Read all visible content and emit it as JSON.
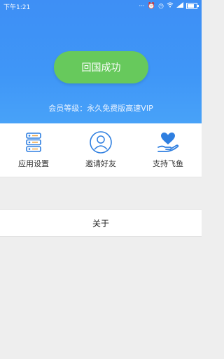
{
  "status_bar": {
    "time": "下午1:21",
    "icons": [
      "dots-icon",
      "alarm-icon",
      "clock-icon",
      "wifi-icon",
      "signal-icon",
      "battery-icon"
    ]
  },
  "hero": {
    "button_label": "回国成功",
    "member_text": "会员等级：永久免费版高速VIP"
  },
  "menu": {
    "items": [
      {
        "label": "应用设置",
        "icon": "settings-stack-icon"
      },
      {
        "label": "邀请好友",
        "icon": "person-circle-icon"
      },
      {
        "label": "支持飞鱼",
        "icon": "heart-hand-icon"
      }
    ]
  },
  "about": {
    "label": "关于"
  },
  "colors": {
    "accent_blue": "#3f96f7",
    "button_green": "#67c95c",
    "icon_blue": "#2f7fe0"
  }
}
